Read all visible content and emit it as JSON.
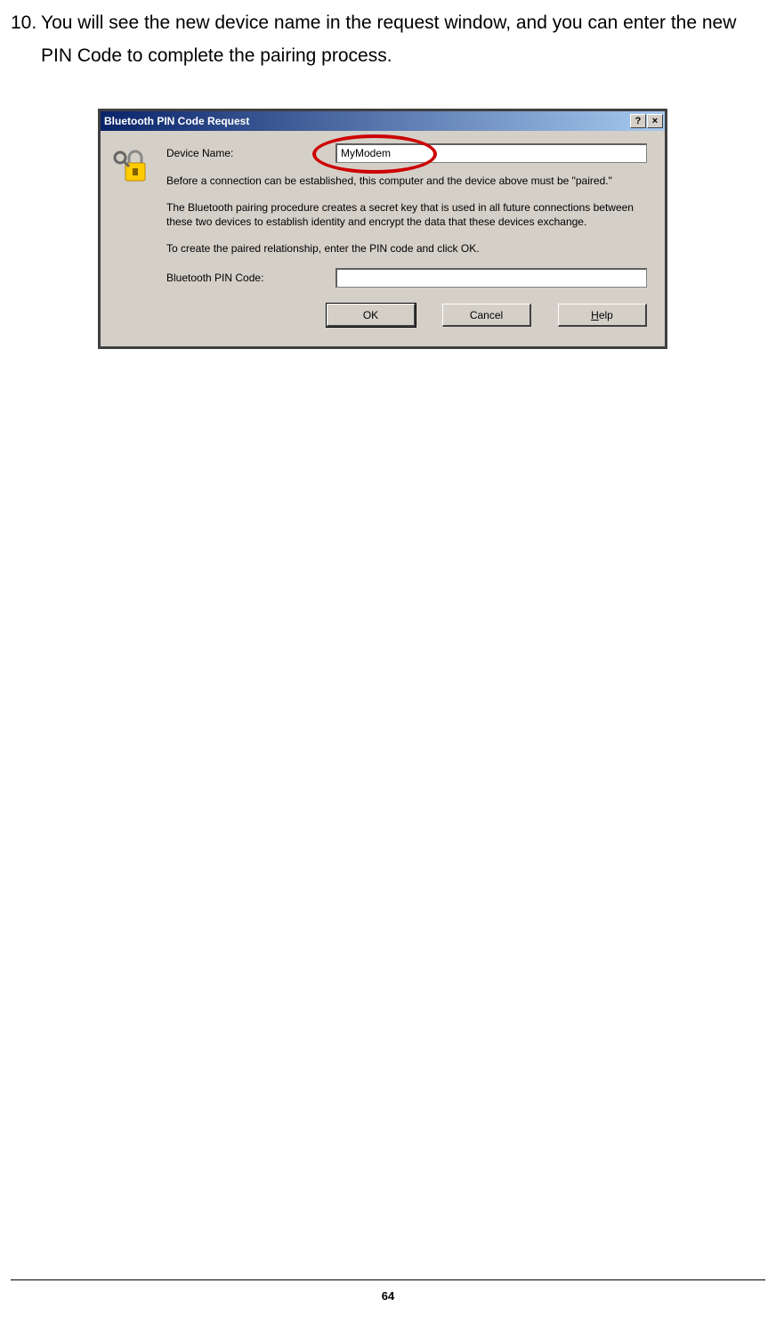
{
  "instruction": {
    "number": "10.",
    "text": "You will see the new device name in the request window, and you can enter the new PIN Code to complete the pairing process."
  },
  "dialog": {
    "title": "Bluetooth PIN Code Request",
    "help_btn": "?",
    "close_btn": "×",
    "device_name_label": "Device Name:",
    "device_name_value": "MyModem",
    "para1": "Before a connection can be established, this computer and the device above must be \"paired.\"",
    "para2": "The Bluetooth pairing procedure creates a secret key that is used in all future connections between these two devices to establish identity and encrypt the data that these devices exchange.",
    "para3": "To create the paired relationship, enter the PIN code and click OK.",
    "pin_label": "Bluetooth PIN Code:",
    "pin_value": "",
    "ok_btn": "OK",
    "cancel_btn": "Cancel",
    "help_btn_label": "Help"
  },
  "page_number": "64"
}
